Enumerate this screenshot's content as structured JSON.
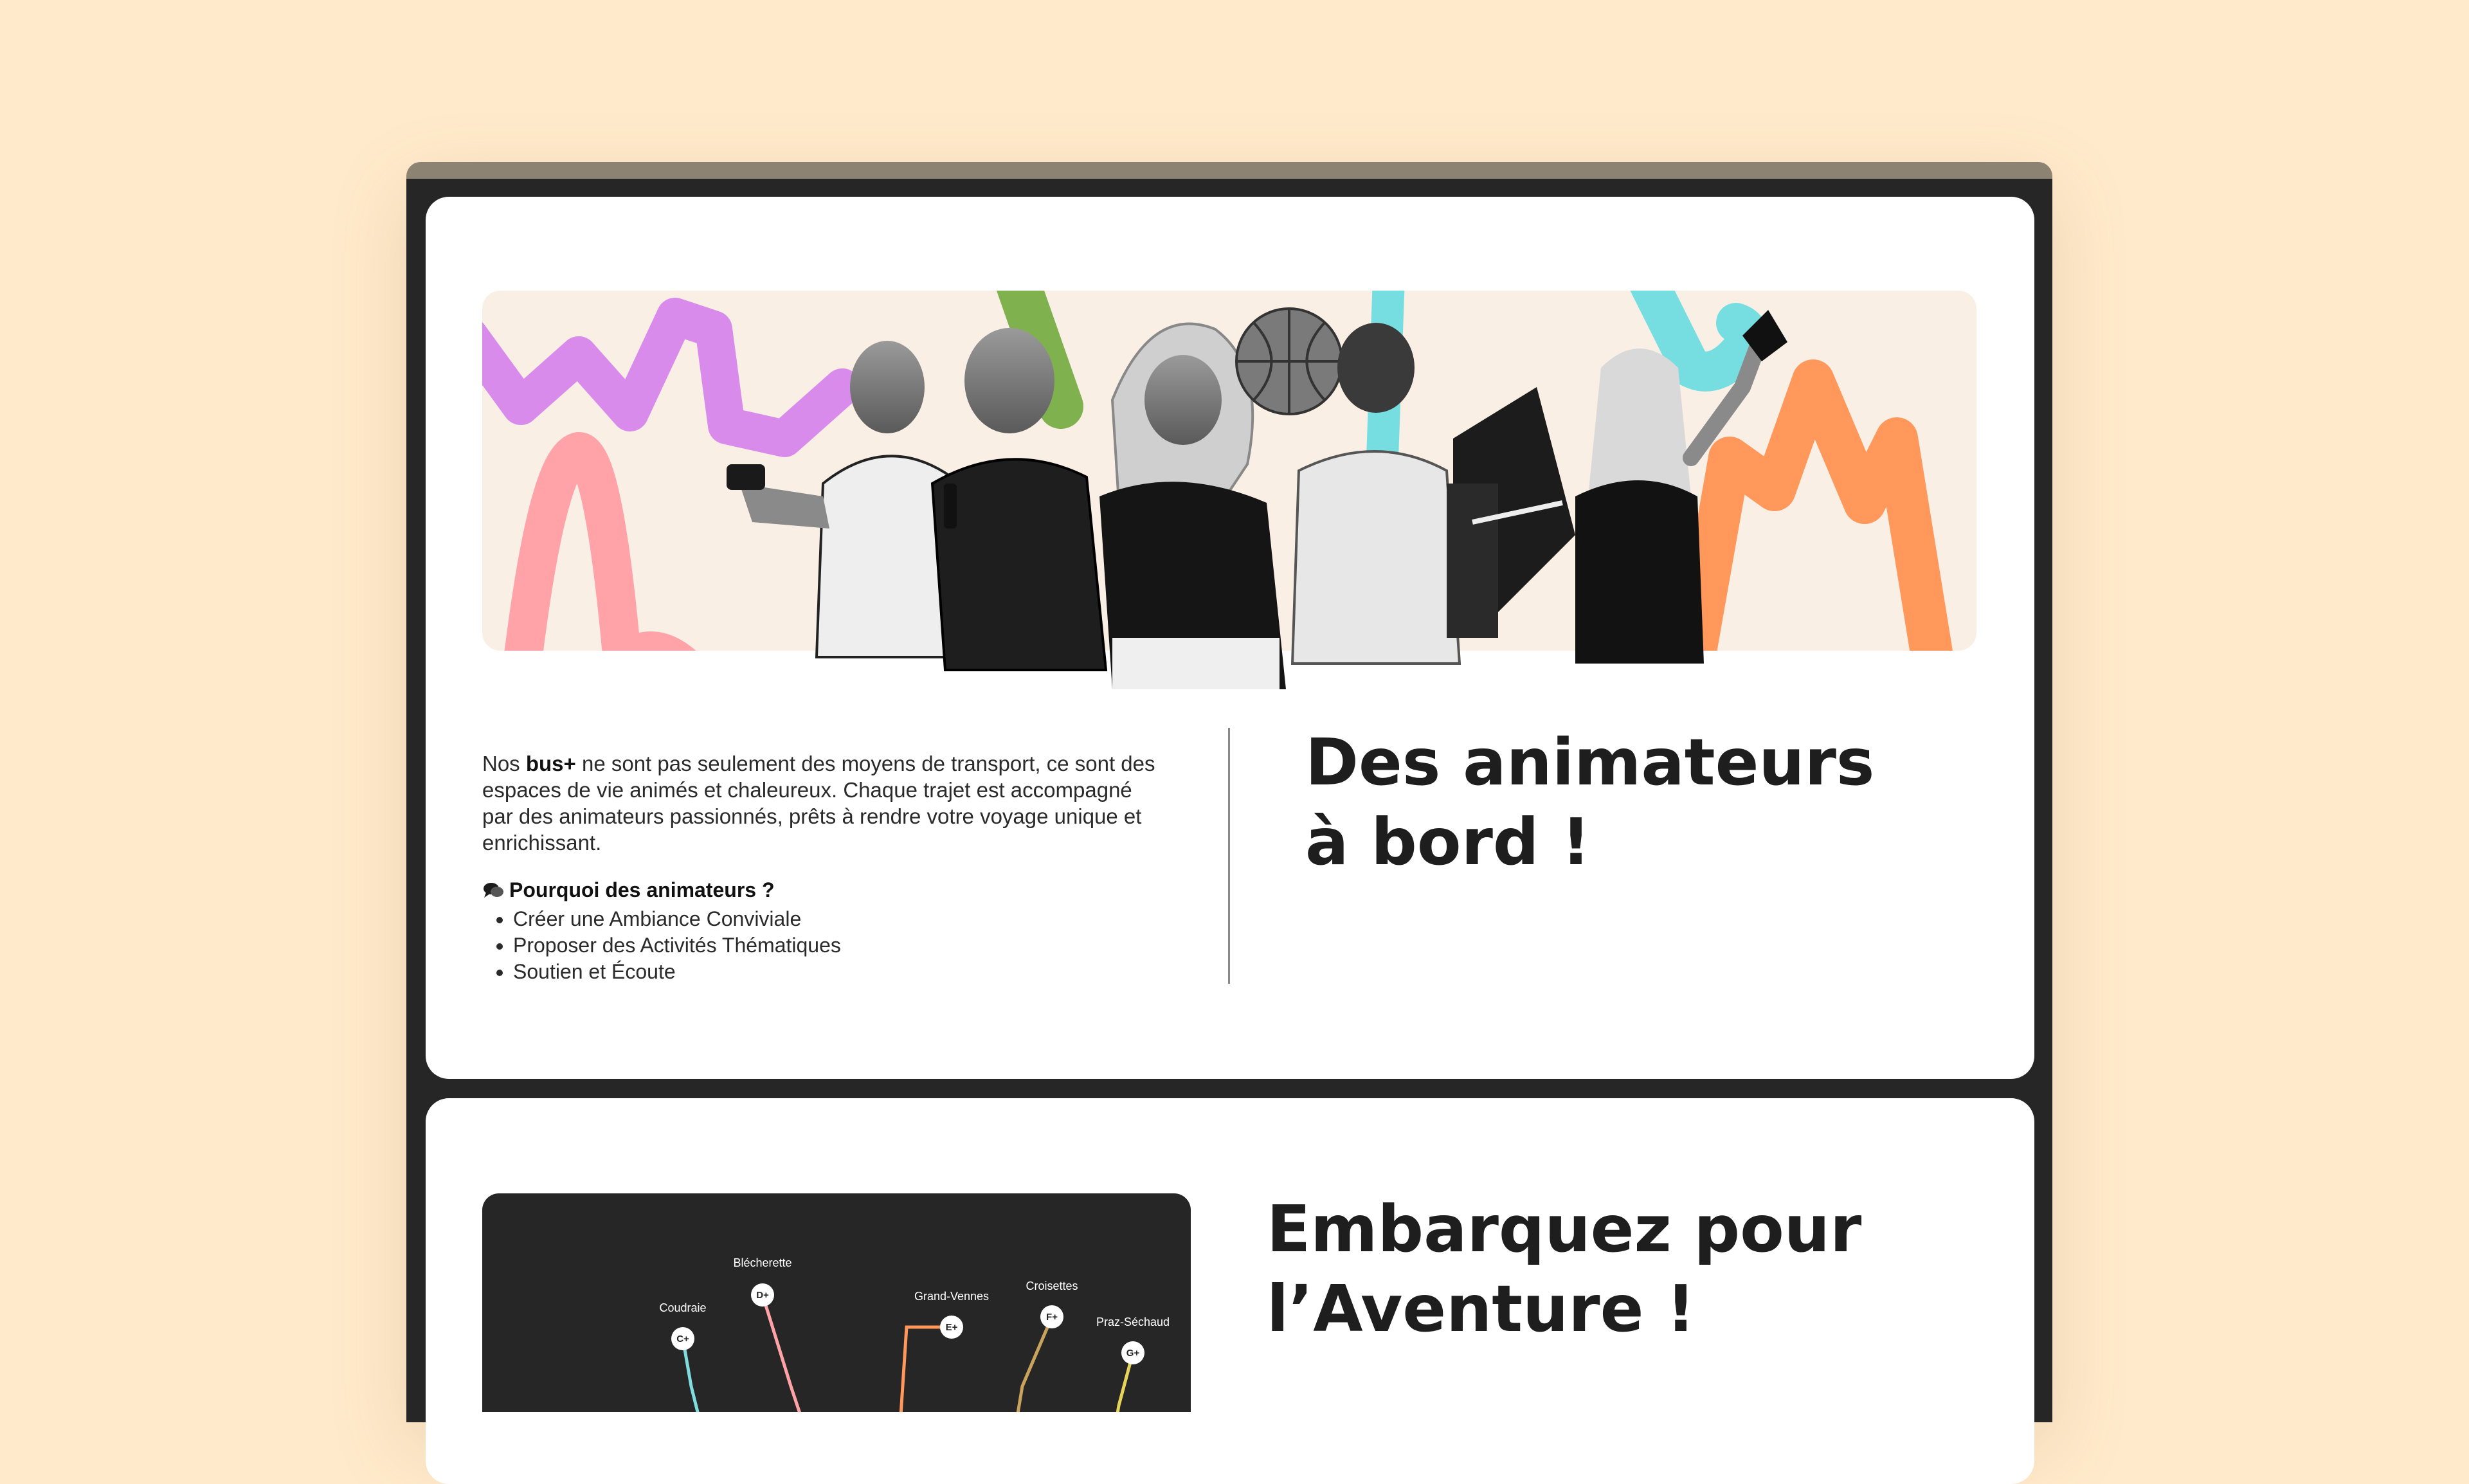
{
  "colors": {
    "page_bg": "#FFEACB",
    "device_frame": "#262626",
    "squiggle_purple": "#D98BEB",
    "squiggle_green": "#7FB24E",
    "squiggle_cyan": "#76DDE0",
    "squiggle_orange": "#FF985A",
    "squiggle_pink": "#FFA3A8"
  },
  "animators": {
    "intro_prefix": "Nos ",
    "intro_brand": "bus+",
    "intro_rest": " ne sont pas seulement des moyens de transport, ce sont des espaces de vie animés et chaleureux. Chaque trajet est accompagné par des animateurs passionnés, prêts à rendre votre voyage unique et enrichissant.",
    "why_icon": "speech-bubbles-icon",
    "why_title": "Pourquoi des animateurs ?",
    "reasons": [
      "Créer une Ambiance Conviviale",
      "Proposer des Activités Thématiques",
      "Soutien et Écoute"
    ],
    "heading": "Des animateurs à bord !"
  },
  "adventure": {
    "heading": "Embarquez pour l’Aventure !",
    "stops": [
      {
        "name": "Coudraie",
        "code": "C+"
      },
      {
        "name": "Blécherette",
        "code": "D+"
      },
      {
        "name": "Grand-Vennes",
        "code": "E+"
      },
      {
        "name": "Croisettes",
        "code": "F+"
      },
      {
        "name": "Praz-Séchaud",
        "code": "G+"
      }
    ]
  }
}
